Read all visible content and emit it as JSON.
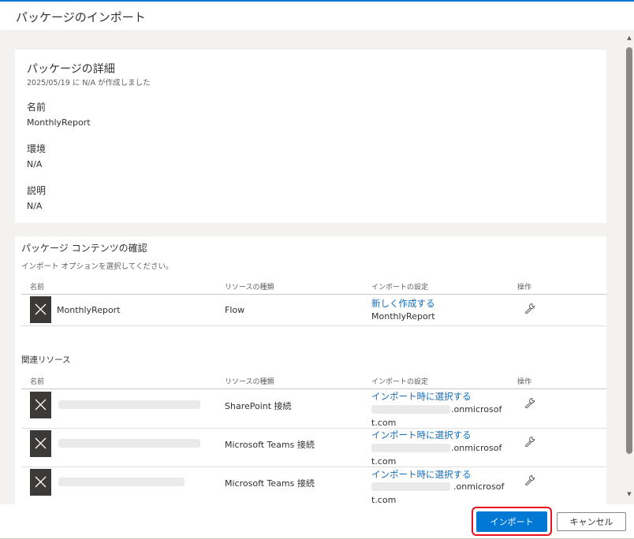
{
  "header": {
    "title": "パッケージのインポート"
  },
  "details": {
    "title": "パッケージの詳細",
    "subtitle": "2025/05/19 に N/A が作成しました",
    "fields": [
      {
        "label": "名前",
        "value": "MonthlyReport"
      },
      {
        "label": "環境",
        "value": "N/A"
      },
      {
        "label": "説明",
        "value": "N/A"
      }
    ]
  },
  "contents": {
    "title": "パッケージ コンテンツの確認",
    "subtitle": "インポート オプションを選択してください。",
    "columns": {
      "name": "名前",
      "type": "リソースの種類",
      "setting": "インポートの設定",
      "action": "操作"
    },
    "rows": [
      {
        "name": "MonthlyReport",
        "type": "Flow",
        "setting_link": "新しく作成する",
        "setting_value": "MonthlyReport"
      }
    ],
    "related_label": "関連リソース",
    "related_rows": [
      {
        "type": "SharePoint 接続",
        "setting_link": "インポート時に選択する",
        "suffix": ".onmicrosof",
        "suffix2": "t.com"
      },
      {
        "type": "Microsoft Teams 接続",
        "setting_link": "インポート時に選択する",
        "suffix": ".onmicrosof",
        "suffix2": "t.com"
      },
      {
        "type": "Microsoft Teams 接続",
        "setting_link": "インポート時に選択する",
        "suffix": ".onmicrosof",
        "suffix2": "t.com"
      }
    ]
  },
  "footer": {
    "import_label": "インポート",
    "cancel_label": "キャンセル"
  },
  "colors": {
    "accent": "#0078d4",
    "link": "#0f6cbd",
    "highlight": "#e81123"
  }
}
